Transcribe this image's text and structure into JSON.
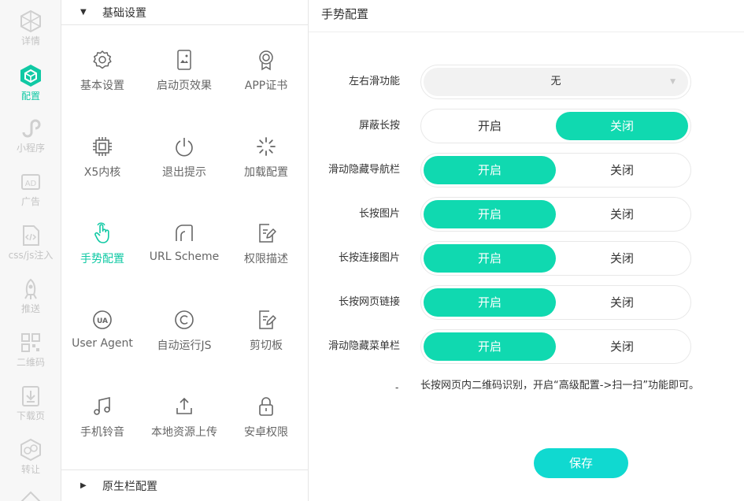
{
  "rail": [
    {
      "label": "详情",
      "icon": "hexagon-icon",
      "active": false
    },
    {
      "label": "配置",
      "icon": "cube-icon",
      "active": true
    },
    {
      "label": "小程序",
      "icon": "miniprogram-icon",
      "active": false
    },
    {
      "label": "广告",
      "icon": "ad-icon",
      "active": false
    },
    {
      "label": "css/js注入",
      "icon": "code-file-icon",
      "active": false
    },
    {
      "label": "推送",
      "icon": "rocket-icon",
      "active": false
    },
    {
      "label": "二维码",
      "icon": "qrcode-icon",
      "active": false
    },
    {
      "label": "下载页",
      "icon": "download-page-icon",
      "active": false
    },
    {
      "label": "转让",
      "icon": "transfer-icon",
      "active": false
    }
  ],
  "panel": {
    "section_top": "基础设置",
    "section_bottom": "原生栏配置",
    "items": [
      {
        "label": "基本设置",
        "icon": "gear-icon"
      },
      {
        "label": "启动页效果",
        "icon": "splash-image-icon"
      },
      {
        "label": "APP证书",
        "icon": "certificate-icon"
      },
      {
        "label": "X5内核",
        "icon": "chip-icon"
      },
      {
        "label": "退出提示",
        "icon": "power-icon"
      },
      {
        "label": "加载配置",
        "icon": "loading-spinner-icon"
      },
      {
        "label": "手势配置",
        "icon": "hand-pointer-icon"
      },
      {
        "label": "URL Scheme",
        "icon": "url-scheme-icon"
      },
      {
        "label": "权限描述",
        "icon": "edit-document-icon"
      },
      {
        "label": "User Agent",
        "icon": "ua-icon"
      },
      {
        "label": "自动运行JS",
        "icon": "copyright-icon"
      },
      {
        "label": "剪切板",
        "icon": "clipboard-edit-icon"
      },
      {
        "label": "手机铃音",
        "icon": "music-note-icon"
      },
      {
        "label": "本地资源上传",
        "icon": "upload-icon"
      },
      {
        "label": "安卓权限",
        "icon": "lock-icon"
      }
    ]
  },
  "main": {
    "title": "手势配置",
    "swipe_label": "左右滑功能",
    "swipe_value": "无",
    "on_label": "开启",
    "off_label": "关闭",
    "toggles": [
      {
        "label": "屏蔽长按",
        "value": "off"
      },
      {
        "label": "滑动隐藏导航栏",
        "value": "on"
      },
      {
        "label": "长按图片",
        "value": "on"
      },
      {
        "label": "长按连接图片",
        "value": "on"
      },
      {
        "label": "长按网页链接",
        "value": "on"
      },
      {
        "label": "滑动隐藏菜单栏",
        "value": "on"
      }
    ],
    "note_dash": "-",
    "note": "长按网页内二维码识别，开启“高级配置->扫一扫”功能即可。",
    "save_label": "保存"
  },
  "colors": {
    "accent": "#10d9b0",
    "rail_active": "#10c9a4",
    "save": "#10d9d0"
  }
}
